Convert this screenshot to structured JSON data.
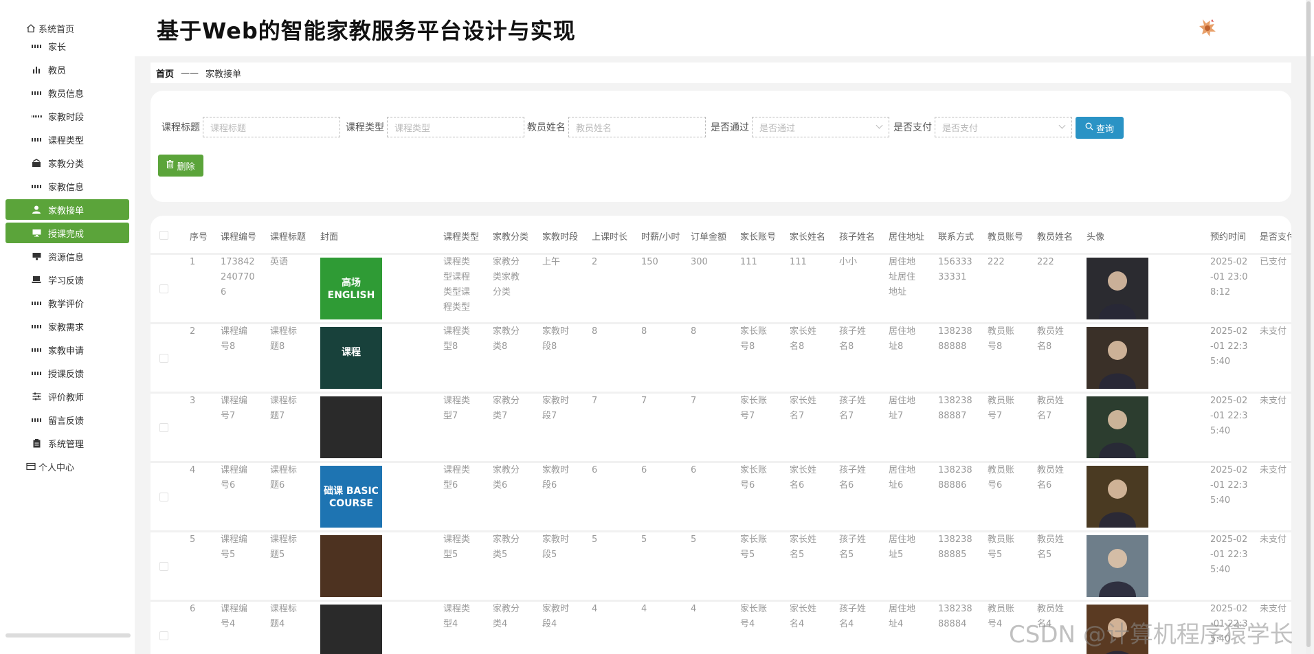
{
  "header": {
    "title": "基于Web的智能家教服务平台设计与实现"
  },
  "sidebar": {
    "items": [
      {
        "label": "系统首页"
      },
      {
        "label": "家长"
      },
      {
        "label": "教员"
      },
      {
        "label": "教员信息"
      },
      {
        "label": "家教时段"
      },
      {
        "label": "课程类型"
      },
      {
        "label": "家教分类"
      },
      {
        "label": "家教信息"
      },
      {
        "label": "家教接单"
      },
      {
        "label": "授课完成"
      },
      {
        "label": "资源信息"
      },
      {
        "label": "学习反馈"
      },
      {
        "label": "教学评价"
      },
      {
        "label": "家教需求"
      },
      {
        "label": "家教申请"
      },
      {
        "label": "授课反馈"
      },
      {
        "label": "评价教师"
      },
      {
        "label": "留言反馈"
      },
      {
        "label": "系统管理"
      },
      {
        "label": "个人中心"
      }
    ]
  },
  "breadcrumb": {
    "home": "首页",
    "separator": "——",
    "current": "家教接单"
  },
  "search": {
    "title_label": "课程标题",
    "title_placeholder": "课程标题",
    "type_label": "课程类型",
    "type_placeholder": "课程类型",
    "teacher_label": "教员姓名",
    "teacher_placeholder": "教员姓名",
    "passed_label": "是否通过",
    "passed_placeholder": "是否通过",
    "paid_label": "是否支付",
    "paid_placeholder": "是否支付",
    "query_label": "查询",
    "delete_label": "删除"
  },
  "table": {
    "headers": [
      "序号",
      "课程编号",
      "课程标题",
      "封面",
      "课程类型",
      "家教分类",
      "家教时段",
      "上课时长",
      "时薪/小时",
      "订单金额",
      "家长账号",
      "家长姓名",
      "孩子姓名",
      "居住地址",
      "联系方式",
      "教员账号",
      "教员姓名",
      "头像",
      "预约时间",
      "是否支付"
    ],
    "rows": [
      {
        "no": "1",
        "code": "1738422407706",
        "title": "英语",
        "type": "课程类型课程类型课程类型",
        "category": "家教分类家教分类",
        "period": "上午",
        "duration": "2",
        "rate": "150",
        "amount": "300",
        "parent_account": "111",
        "parent_name": "111",
        "child_name": "小小",
        "address": "居住地址居住地址",
        "phone": "15633333331",
        "teacher_account": "222",
        "teacher_name": "222",
        "time": "2025-02-01 23:08:12",
        "paid": "已支付"
      },
      {
        "no": "2",
        "code": "课程编号8",
        "title": "课程标题8",
        "type": "课程类型8",
        "category": "家教分类8",
        "period": "家教时段8",
        "duration": "8",
        "rate": "8",
        "amount": "8",
        "parent_account": "家长账号8",
        "parent_name": "家长姓名8",
        "child_name": "孩子姓名8",
        "address": "居住地址8",
        "phone": "13823888888",
        "teacher_account": "教员账号8",
        "teacher_name": "教员姓名8",
        "time": "2025-02-01 22:35:40",
        "paid": "未支付"
      },
      {
        "no": "3",
        "code": "课程编号7",
        "title": "课程标题7",
        "type": "课程类型7",
        "category": "家教分类7",
        "period": "家教时段7",
        "duration": "7",
        "rate": "7",
        "amount": "7",
        "parent_account": "家长账号7",
        "parent_name": "家长姓名7",
        "child_name": "孩子姓名7",
        "address": "居住地址7",
        "phone": "13823888887",
        "teacher_account": "教员账号7",
        "teacher_name": "教员姓名7",
        "time": "2025-02-01 22:35:40",
        "paid": "未支付"
      },
      {
        "no": "4",
        "code": "课程编号6",
        "title": "课程标题6",
        "type": "课程类型6",
        "category": "家教分类6",
        "period": "家教时段6",
        "duration": "6",
        "rate": "6",
        "amount": "6",
        "parent_account": "家长账号6",
        "parent_name": "家长姓名6",
        "child_name": "孩子姓名6",
        "address": "居住地址6",
        "phone": "13823888886",
        "teacher_account": "教员账号6",
        "teacher_name": "教员姓名6",
        "time": "2025-02-01 22:35:40",
        "paid": "未支付"
      },
      {
        "no": "5",
        "code": "课程编号5",
        "title": "课程标题5",
        "type": "课程类型5",
        "category": "家教分类5",
        "period": "家教时段5",
        "duration": "5",
        "rate": "5",
        "amount": "5",
        "parent_account": "家长账号5",
        "parent_name": "家长姓名5",
        "child_name": "孩子姓名5",
        "address": "居住地址5",
        "phone": "13823888885",
        "teacher_account": "教员账号5",
        "teacher_name": "教员姓名5",
        "time": "2025-02-01 22:35:40",
        "paid": "未支付"
      },
      {
        "no": "6",
        "code": "课程编号4",
        "title": "课程标题4",
        "type": "课程类型4",
        "category": "家教分类4",
        "period": "家教时段4",
        "duration": "4",
        "rate": "4",
        "amount": "4",
        "parent_account": "家长账号4",
        "parent_name": "家长姓名4",
        "child_name": "孩子姓名4",
        "address": "居住地址4",
        "phone": "13823888884",
        "teacher_account": "教员账号4",
        "teacher_name": "教员姓名4",
        "time": "2025-02-01 22:35:40",
        "paid": "未支付"
      }
    ],
    "cover_images": {
      "1": {
        "bg": "#2f9b35",
        "text": "高场 ENGLISH"
      },
      "2": {
        "bg": "#18413b",
        "text": "课程"
      },
      "3": {
        "bg": "#2a2a2a",
        "text": ""
      },
      "4": {
        "bg": "#1e74b2",
        "text": "础课 BASIC COURSE"
      },
      "5": {
        "bg": "#4d3220",
        "text": ""
      },
      "6": {
        "bg": "#2a2a2a",
        "text": ""
      }
    }
  },
  "watermark": "CSDN @计算机程序猿学长",
  "colors": {
    "accent_green": "#5ba43a",
    "accent_blue": "#2a93c5"
  }
}
